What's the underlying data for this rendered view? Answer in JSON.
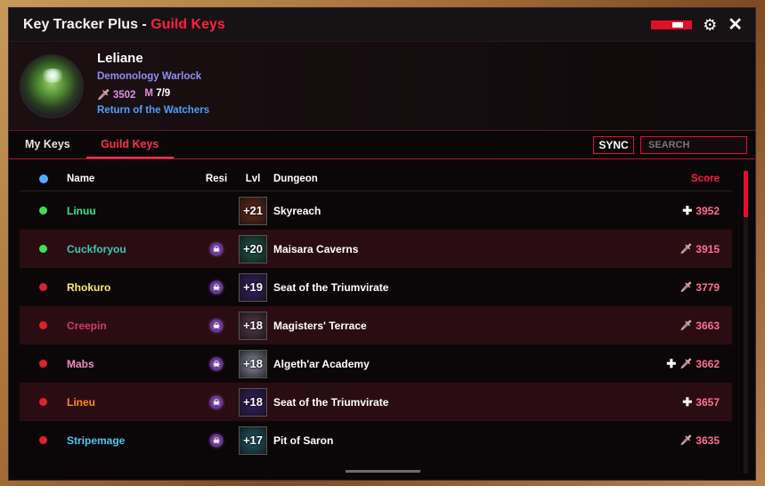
{
  "window": {
    "title_main": "Key Tracker Plus - ",
    "title_accent": "Guild Keys"
  },
  "profile": {
    "name": "Leliane",
    "spec": "Demonology Warlock",
    "score": "3502",
    "mythic_label": "M",
    "mythic_progress": "7/9",
    "guild": "Return of the Watchers"
  },
  "tabs": [
    {
      "label": "My Keys",
      "active": false
    },
    {
      "label": "Guild Keys",
      "active": true
    }
  ],
  "sync_label": "SYNC",
  "search": {
    "placeholder": "SEARCH",
    "value": ""
  },
  "table": {
    "headers": {
      "name": "Name",
      "resi": "Resi",
      "lvl": "Lvl",
      "dungeon": "Dungeon",
      "score": "Score"
    },
    "rows": [
      {
        "status": "online",
        "name": "Linuu",
        "name_color": "#3ee08a",
        "resi": false,
        "level": "+21",
        "dungeon": "Skyreach",
        "roles": [
          "heal"
        ],
        "score": "3952",
        "key_color": "#6a2a1a"
      },
      {
        "status": "online",
        "name": "Cuckforyou",
        "name_color": "#3ec7b0",
        "resi": true,
        "level": "+20",
        "dungeon": "Maisara Caverns",
        "roles": [
          "dps"
        ],
        "score": "3915",
        "key_color": "#1f5a4a"
      },
      {
        "status": "offline",
        "name": "Rhokuro",
        "name_color": "#ffe770",
        "resi": true,
        "level": "+19",
        "dungeon": "Seat of the Triumvirate",
        "roles": [
          "dps"
        ],
        "score": "3779",
        "key_color": "#3a1f6a"
      },
      {
        "status": "offline",
        "name": "Creepin",
        "name_color": "#d03a6a",
        "resi": true,
        "level": "+18",
        "dungeon": "Magisters' Terrace",
        "roles": [
          "dps"
        ],
        "score": "3663",
        "key_color": "#5a3a4a"
      },
      {
        "status": "offline",
        "name": "Mabs",
        "name_color": "#f48cba",
        "resi": true,
        "level": "+18",
        "dungeon": "Algeth'ar Academy",
        "roles": [
          "heal",
          "dps"
        ],
        "score": "3662",
        "key_color": "#8a8aa0"
      },
      {
        "status": "offline",
        "name": "Lineu",
        "name_color": "#ff8c1a",
        "resi": true,
        "level": "+18",
        "dungeon": "Seat of the Triumvirate",
        "roles": [
          "heal"
        ],
        "score": "3657",
        "key_color": "#3a1f6a"
      },
      {
        "status": "offline",
        "name": "Stripemage",
        "name_color": "#4fc6f0",
        "resi": true,
        "level": "+17",
        "dungeon": "Pit of Saron",
        "roles": [
          "dps"
        ],
        "score": "3635",
        "key_color": "#1f5a6a"
      }
    ]
  },
  "colors": {
    "accent": "#ff2040",
    "online": "#3ee05a",
    "offline": "#e0202e",
    "header_dot": "#5aa8ff"
  },
  "icons": {
    "settings": "gear-icon",
    "close": "close-icon",
    "heal_role": "plus-icon",
    "dps_role": "dagger-icon",
    "resilient": "skull-icon"
  }
}
